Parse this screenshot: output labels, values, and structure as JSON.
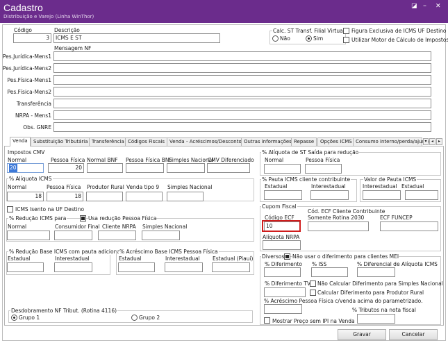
{
  "window": {
    "title": "Cadastro",
    "subtitle": "Distribuição e Varejo (Linha WinThor)",
    "controls": {
      "maximize": "◪",
      "minimize": "–",
      "close": "✕"
    },
    "accent": "#6b2c8c"
  },
  "header": {
    "codigo_label": "Código",
    "codigo_value": "3",
    "descricao_label": "Descrição",
    "descricao_value": "ICMS E ST",
    "calc_label": "Calc. ST Transf. Filial Virtual",
    "nao_label": "Não",
    "sim_label": "Sim",
    "calc_selected": "Sim",
    "fig_excl_label": "Figura Exclusiva de ICMS UF Destino",
    "motor_label": "Utilizar Motor de Cálculo de Impostos",
    "msg_nf_label": "Mensagem NF",
    "rows": [
      {
        "label": "Pes.Jurídica-Mens1",
        "value": ""
      },
      {
        "label": "Pes.Jurídica-Mens2",
        "value": ""
      },
      {
        "label": "Pes.Física-Mens1",
        "value": ""
      },
      {
        "label": "Pes.Física-Mens2",
        "value": ""
      },
      {
        "label": "Transferência",
        "value": ""
      },
      {
        "label": "NRPA - Mens1",
        "value": ""
      },
      {
        "label": "Obs. GNRE",
        "value": ""
      }
    ]
  },
  "tabs": [
    "Venda",
    "Substituição Tributária",
    "Transferência",
    "Códigos Fiscais",
    "Venda - Acréscimos/Descontos",
    "Outras informações",
    "Repasse",
    "Opções ICMS",
    "Consumo interno/perda/ajuste"
  ],
  "impostos_cmv": {
    "title": "Impostos CMV",
    "normal": "Normal",
    "pessoa_fisica": "Pessoa Física",
    "normal_bnf": "Normal BNF",
    "pessoa_fisica_bnf": "Pessoa Física BNF",
    "simples": "Simples Nacional",
    "cmv_dif": "CMV Diferenciado",
    "normal_value": "20",
    "pf_value": "20"
  },
  "aliquota_icms": {
    "title": "% Alíquota ICMS",
    "normal": "Normal",
    "pessoa_fisica": "Pessoa Física",
    "produtor_rural": "Produtor Rural",
    "venda_tipo9": "Venda tipo 9",
    "simples": "Simples Nacional",
    "normal_value": "18",
    "pf_value": "18"
  },
  "icms_isento_label": "ICMS Isento na UF Destino",
  "reducao_icms": {
    "title": "% Redução ICMS para",
    "usa_label": "Usa redução Pessoa Física",
    "normal": "Normal",
    "consumidor_final": "Consumidor Final",
    "cliente_nrpa": "Cliente NRPA",
    "simples": "Simples Nacional"
  },
  "reducao_base": {
    "title": "% Redução Base ICMS com pauta adicionais",
    "estadual": "Estadual",
    "interestadual": "Interestadual"
  },
  "acrescimo_base": {
    "title": "% Acréscimo Base ICMS Pessoa Física",
    "estadual": "Estadual",
    "interestadual": "Interestadual",
    "estadual_piaui": "Estadual (Piauí)"
  },
  "desdobramento": {
    "title": "Desdobramento NF Tribut. (Rotina 4116)",
    "grupo1": "Grupo 1",
    "grupo2": "Grupo 2",
    "selected": "Grupo 1"
  },
  "aliquota_st": {
    "title": "% Alíquota de ST Saída para redução",
    "normal": "Normal",
    "pessoa_fisica": "Pessoa Física"
  },
  "pauta_icms": {
    "title": "% Pauta ICMS cliente contribuinte",
    "estadual": "Estadual",
    "interestadual": "Interestadual"
  },
  "valor_pauta": {
    "title": "Valor de Pauta ICMS",
    "interestadual": "Interestadual",
    "estadual": "Estadual"
  },
  "cupom": {
    "title": "Cupom Fiscal",
    "cod_ecf_cliente": "Cód. ECF Cliente Contribuinte",
    "somente": "Somente Rotina 2030",
    "ecf_funcep": "ECF FUNCEP",
    "codigo_ecf": "Código ECF",
    "codigo_ecf_value": "10",
    "aliquota_nrpa": "Alíquota NRPA",
    "highlight": "#d01c1c"
  },
  "diversos": {
    "title": "Diversos",
    "nao_usar": "Não usar o diferimento para clientes MEI",
    "dif": "% Diferimento",
    "iss": "% ISS",
    "dif_aliq": "% Diferencial de Alíquota ICMS",
    "dif_tv9": "% Diferimento TV9",
    "nao_calc": "Não Calcular Diferimento para Simples Nacional",
    "calc_prod": "Calcular Diferimento para Produtor Rural",
    "acresc_pf": "% Acréscimo Pessoa Física c/venda acima do parametrizado.",
    "tributos": "% Tributos na nota fiscal",
    "mostrar": "Mostrar Preço sem IPI na Venda"
  },
  "buttons": {
    "gravar": "Gravar",
    "cancelar": "Cancelar"
  }
}
